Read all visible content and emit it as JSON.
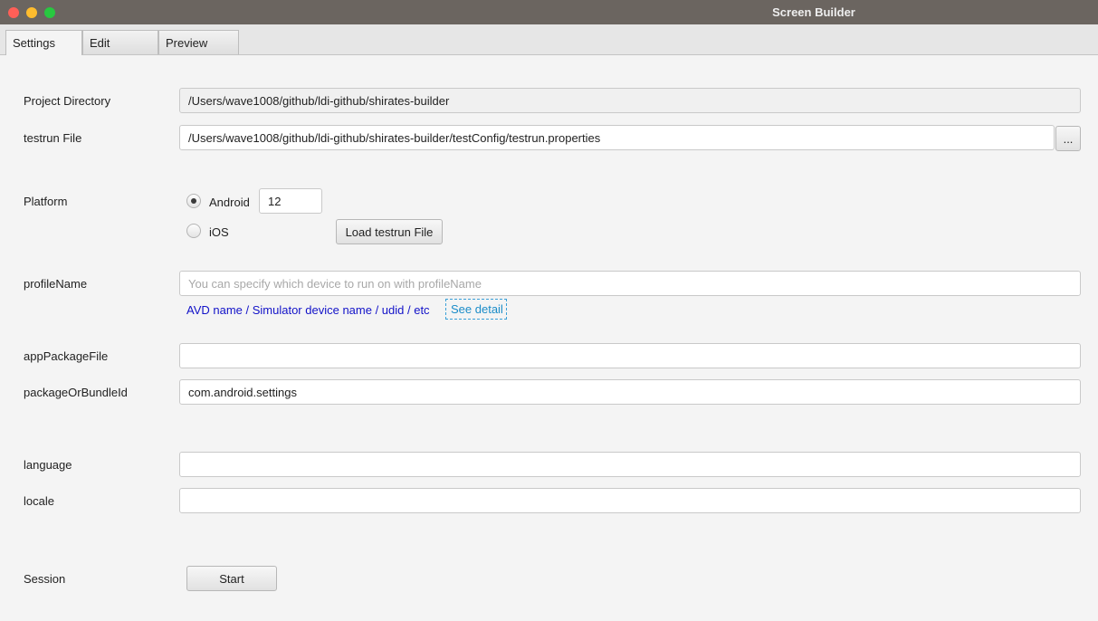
{
  "window": {
    "title": "Screen Builder"
  },
  "tabs": [
    {
      "label": "Settings",
      "active": true
    },
    {
      "label": "Edit",
      "active": false
    },
    {
      "label": "Preview",
      "active": false
    }
  ],
  "settings": {
    "project_directory": {
      "label": "Project Directory",
      "value": "/Users/wave1008/github/ldi-github/shirates-builder"
    },
    "testrun_file": {
      "label": "testrun File",
      "value": "/Users/wave1008/github/ldi-github/shirates-builder/testConfig/testrun.properties",
      "browse_label": "..."
    },
    "platform": {
      "label": "Platform",
      "options": [
        {
          "label": "Android",
          "selected": true
        },
        {
          "label": "iOS",
          "selected": false
        }
      ],
      "version": "12",
      "load_button": "Load  testrun File"
    },
    "profile_name": {
      "label": "profileName",
      "value": "",
      "placeholder": "You can specify which device to run on with profileName",
      "hint": "AVD name / Simulator device name / udid / etc",
      "see_detail": "See detail"
    },
    "app_package_file": {
      "label": "appPackageFile",
      "value": ""
    },
    "package_or_bundle_id": {
      "label": "packageOrBundleId",
      "value": "com.android.settings"
    },
    "language": {
      "label": "language",
      "value": ""
    },
    "locale": {
      "label": "locale",
      "value": ""
    },
    "session": {
      "label": "Session",
      "start_button": "Start"
    }
  }
}
